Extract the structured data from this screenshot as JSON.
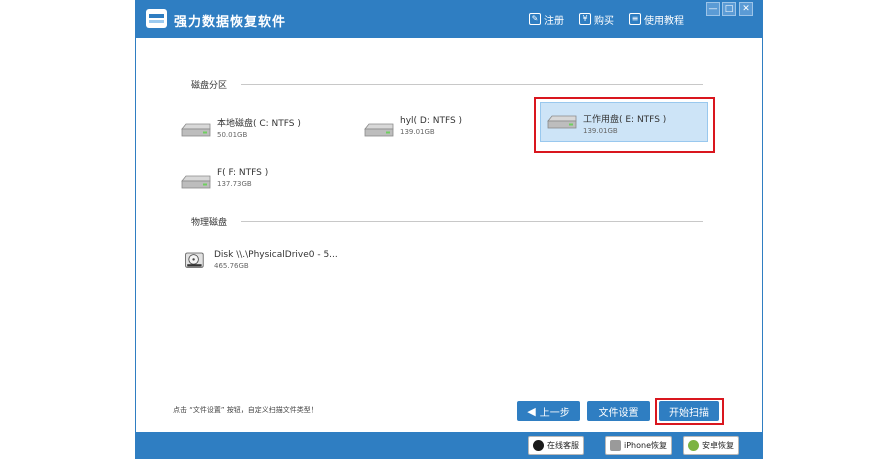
{
  "window": {
    "title": "强力数据恢复软件",
    "toolbar": {
      "register": "注册",
      "buy": "购买",
      "tutorial": "使用教程"
    },
    "controls": {
      "minimize": "—",
      "maximize": "□",
      "close": "✕"
    }
  },
  "sections": {
    "partitions_label": "磁盘分区",
    "physical_label": "物理磁盘"
  },
  "partitions": [
    {
      "name": "本地磁盘( C: NTFS )",
      "size": "50.01GB"
    },
    {
      "name": "hyl( D: NTFS )",
      "size": "139.01GB"
    },
    {
      "name": "工作用盘( E: NTFS )",
      "size": "139.01GB"
    },
    {
      "name": "F( F: NTFS )",
      "size": "137.73GB"
    }
  ],
  "physical": [
    {
      "name": "Disk \\\\.\\PhysicalDrive0 - 5...",
      "size": "465.76GB"
    }
  ],
  "hint": "点击 “文件设置” 按钮，自定义扫描文件类型！",
  "buttons": {
    "back": "上一步",
    "settings": "文件设置",
    "start": "开始扫描"
  },
  "bottom": {
    "service": "在线客服",
    "iphone": "iPhone恢复",
    "android": "安卓恢复"
  },
  "colors": {
    "accent": "#2f7ec2",
    "highlight": "#d9161e",
    "selected_bg": "#cde4f7"
  }
}
